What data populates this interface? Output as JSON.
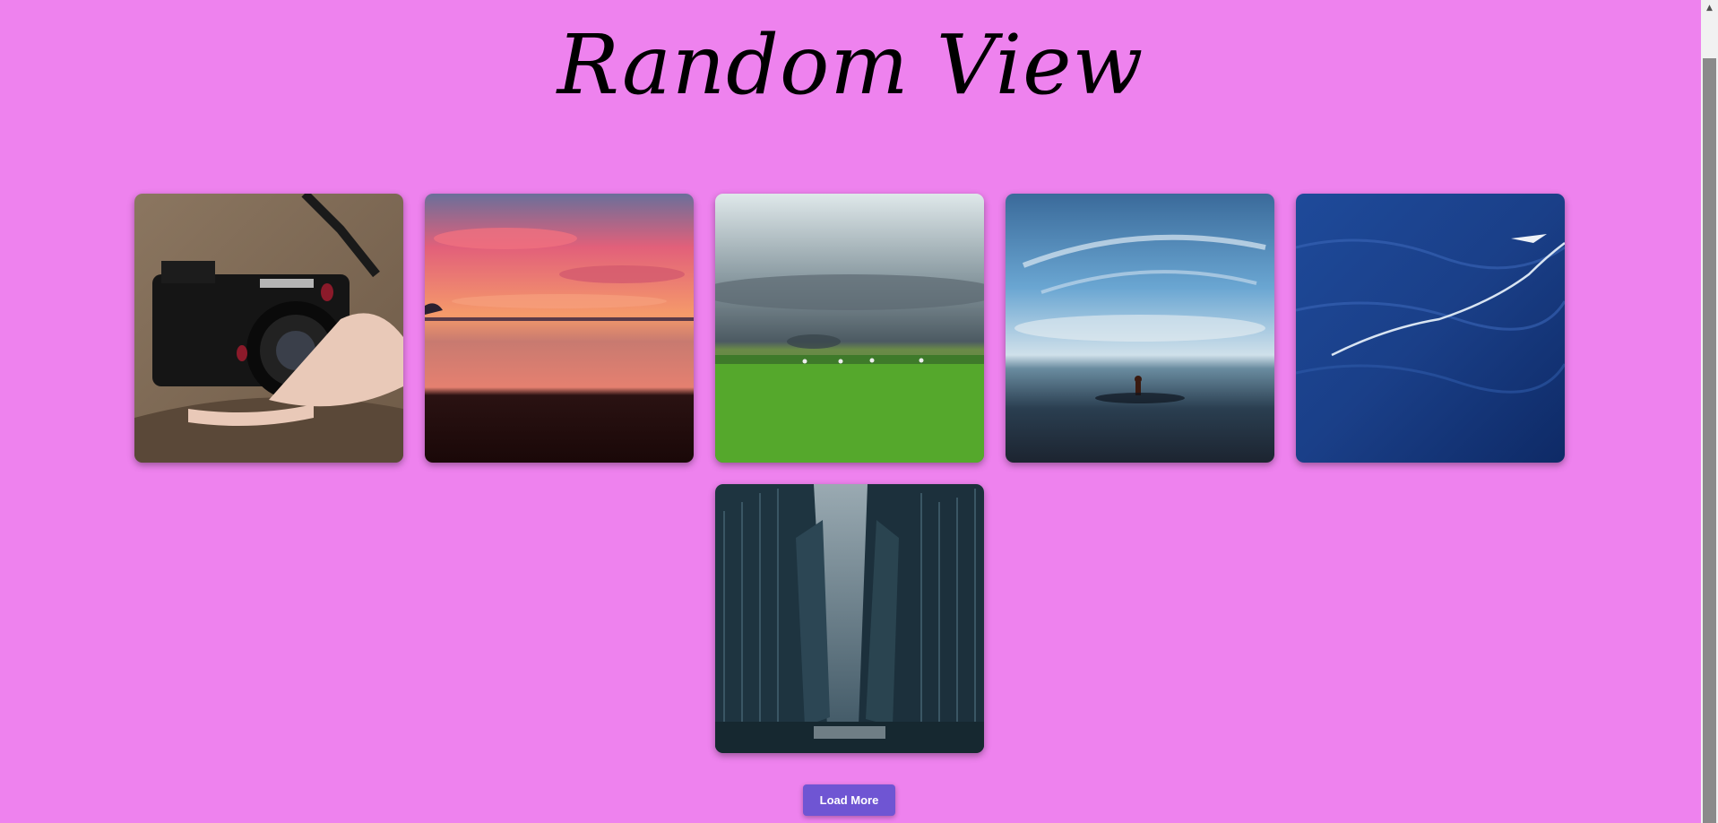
{
  "page": {
    "title": "Random View",
    "background_color": "#ee82ee"
  },
  "gallery": {
    "photos": [
      {
        "name": "camera-photo",
        "subject": "hand holding camera"
      },
      {
        "name": "sunset-beach-photo",
        "subject": "sunset over beach"
      },
      {
        "name": "green-field-photo",
        "subject": "cloudy sky over green field"
      },
      {
        "name": "sea-person-photo",
        "subject": "person in sea under blue sky"
      },
      {
        "name": "ocean-water-photo",
        "subject": "deep blue ocean water"
      },
      {
        "name": "city-street-photo",
        "subject": "city street between skyscrapers"
      }
    ]
  },
  "actions": {
    "load_more_label": "Load More",
    "button_color": "#6f55d3"
  },
  "scrollbar": {
    "up_arrow_icon": "triangle-up"
  }
}
